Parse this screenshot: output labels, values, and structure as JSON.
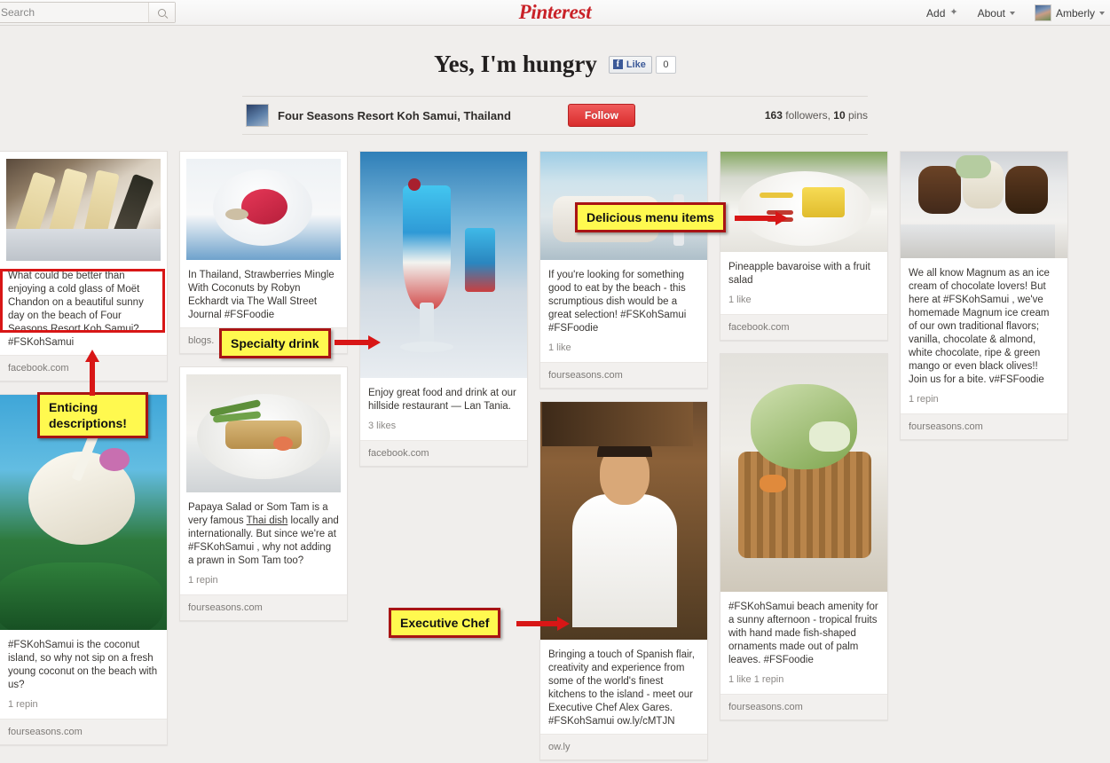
{
  "topbar": {
    "search": {
      "placeholder": "Search",
      "value": "",
      "icon": "search-icon"
    },
    "brand": "Pinterest",
    "add_label": "Add",
    "about_label": "About",
    "user_label": "Amberly"
  },
  "board": {
    "title": "Yes, I'm hungry",
    "facebook_like_label": "Like",
    "facebook_like_count": "0",
    "owner_name": "Four Seasons Resort Koh Samui, Thailand",
    "follow_label": "Follow",
    "followers_count": "163",
    "followers_word": "followers,",
    "pins_count": "10",
    "pins_word": "pins"
  },
  "pins": {
    "champagne": {
      "desc": "What could be better than enjoying a cold glass of Moët Chandon on a beautiful sunny day on the beach of Four Seasons Resort Koh Samui? #FSKohSamui",
      "source": "facebook.com"
    },
    "coconut": {
      "desc": "#FSKohSamui is the coconut island, so why not sip on a fresh young coconut on the beach with us?",
      "likes": "1 repin",
      "source": "fourseasons.com"
    },
    "strawberries": {
      "desc": "In Thailand, Strawberries Mingle With Coconuts by Robyn Eckhardt via The Wall Street Journal #FSFoodie",
      "source": "blogs."
    },
    "papaya": {
      "desc_part1": "Papaya Salad or Som Tam is a very famous ",
      "desc_link": "Thai dish",
      "desc_part2": " locally and internationally. But since we're at #FSKohSamui , why not adding a prawn in Som Tam too?",
      "likes": "1 repin",
      "source": "fourseasons.com"
    },
    "blue_drink": {
      "desc": "Enjoy great food and drink at our hillside restaurant — Lan Tania.",
      "likes": "3 likes",
      "source": "facebook.com"
    },
    "beach_dish": {
      "desc": "If you're looking for something good to eat by the beach - this scrumptious dish would be a great selection! #FSKohSamui #FSFoodie",
      "likes": "1 like",
      "source": "fourseasons.com"
    },
    "chef": {
      "desc": "Bringing a touch of Spanish flair, creativity and experience from some of the world's finest kitchens to the island - meet our Executive Chef Alex Gares. #FSKohSamui ow.ly/cMTJN",
      "source": "ow.ly"
    },
    "pineapple": {
      "desc": "Pineapple bavaroise with a fruit salad",
      "likes": "1 like",
      "source": "facebook.com"
    },
    "palm_basket": {
      "desc": "#FSKohSamui beach amenity for a sunny afternoon - tropical fruits with hand made fish-shaped ornaments made out of palm leaves. #FSFoodie",
      "likes": "1 like   1 repin",
      "source": "fourseasons.com"
    },
    "magnum": {
      "desc": "We all know Magnum as an ice cream of chocolate lovers! But here at #FSKohSamui , we've homemade Magnum ice cream of our own traditional flavors; vanilla, chocolate & almond, white chocolate, ripe & green mango or even black olives!! Join us for a bite. v#FSFoodie",
      "likes": "1 repin",
      "source": "fourseasons.com"
    }
  },
  "annotations": {
    "enticing": "Enticing\ndescriptions!",
    "specialty_drink": "Specialty drink",
    "delicious_menu": "Delicious menu items",
    "executive_chef": "Executive Chef"
  },
  "colors": {
    "brand_red": "#c92228",
    "follow_red": "#d92d2d",
    "annotation_yellow": "#fff94f",
    "annotation_border": "#a81414",
    "arrow_red": "#d81616"
  }
}
